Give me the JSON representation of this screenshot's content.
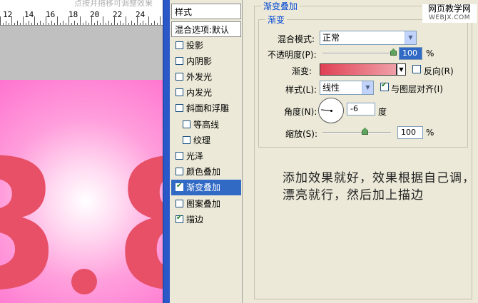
{
  "canvas": {
    "ruler_hint": "点按并拖移可调整效果",
    "ruler_numbers": [
      "12",
      "14",
      "16",
      "18",
      "20",
      "22",
      "24"
    ],
    "digit_left": "3",
    "digit_right": "8"
  },
  "styles_list": {
    "header": "样式",
    "blend_options": "混合选项:默认",
    "items": [
      {
        "label": "投影",
        "checked": false
      },
      {
        "label": "内阴影",
        "checked": false
      },
      {
        "label": "外发光",
        "checked": false
      },
      {
        "label": "内发光",
        "checked": false
      },
      {
        "label": "斜面和浮雕",
        "checked": false
      },
      {
        "label": "等高线",
        "checked": false
      },
      {
        "label": "纹理",
        "checked": false
      },
      {
        "label": "光泽",
        "checked": false
      },
      {
        "label": "颜色叠加",
        "checked": false
      },
      {
        "label": "渐变叠加",
        "checked": true,
        "selected": true
      },
      {
        "label": "图案叠加",
        "checked": false
      },
      {
        "label": "描边",
        "checked": true
      }
    ]
  },
  "panel": {
    "outer_title": "渐变叠加",
    "inner_title": "渐变",
    "blend_mode_label": "混合模式:",
    "blend_mode_value": "正常",
    "opacity_label": "不透明度(P):",
    "opacity_value": "100",
    "opacity_unit": "%",
    "opacity_level": 1.0,
    "gradient_label": "渐变:",
    "reverse_label": "反向(R)",
    "reverse_checked": false,
    "style_label": "样式(L):",
    "style_value": "线性",
    "align_label": "与图层对齐(I)",
    "align_checked": true,
    "angle_label": "角度(N):",
    "angle_value": "-6",
    "angle_unit": "度",
    "scale_label": "缩放(S):",
    "scale_value": "100",
    "scale_unit": "%",
    "gradient_colors": [
      "#e04055",
      "#f0a0a8"
    ]
  },
  "watermark": {
    "title": "网页教学网",
    "site": "WEBJX.COM"
  },
  "note": "添加效果就好，效果根据自己调，漂亮就行，然后加上描边"
}
